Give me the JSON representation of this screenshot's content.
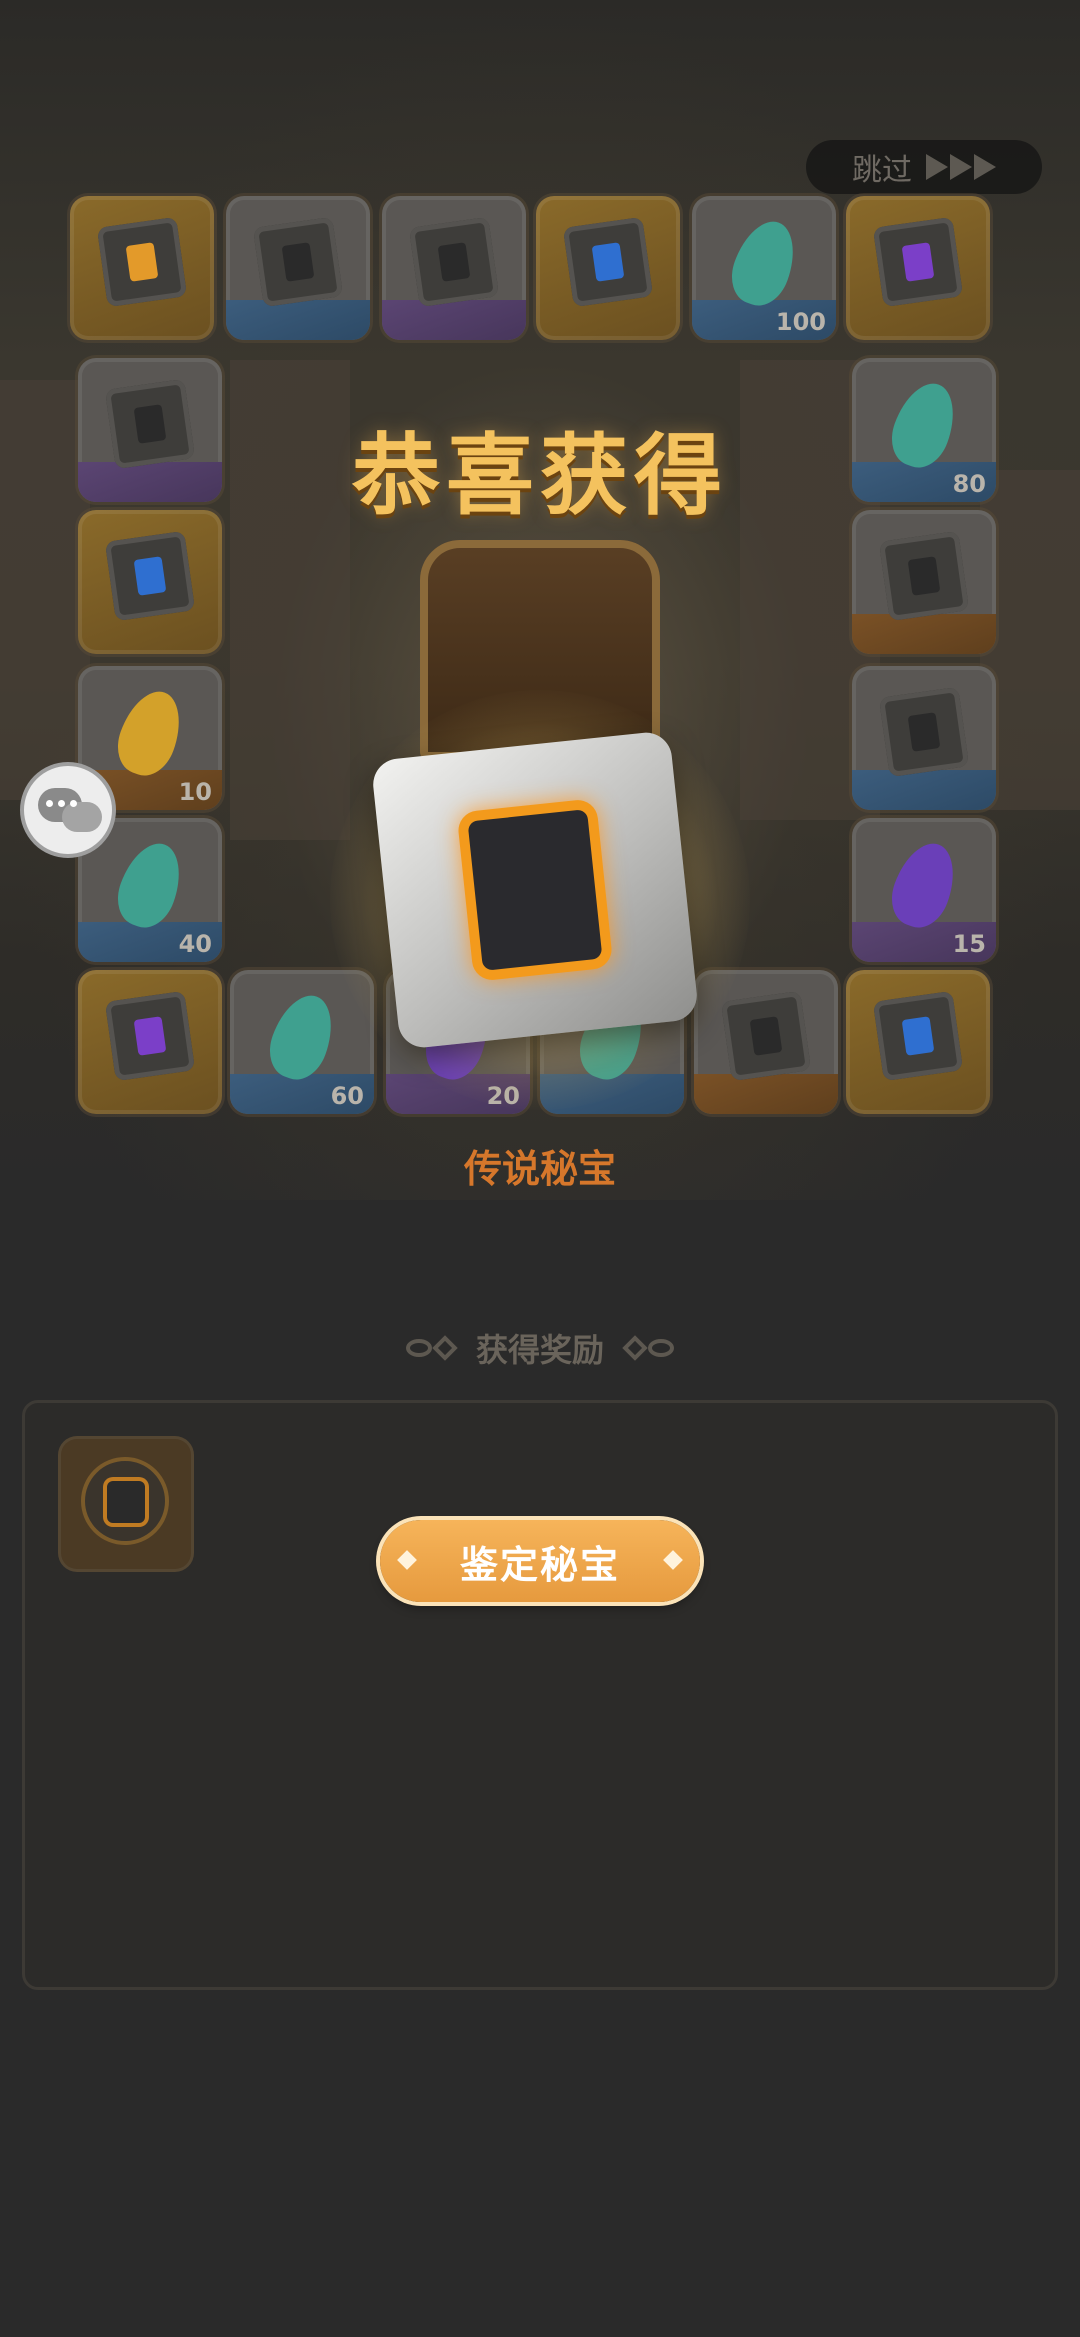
{
  "header": {
    "skip_label": "跳过"
  },
  "title": "恭喜获得",
  "item": {
    "name": "传说秘宝"
  },
  "rewards": {
    "header": "获得奖励"
  },
  "actions": {
    "appraise_label": "鉴定秘宝"
  },
  "grid_tiles": [
    {
      "type": "cube",
      "frame": "gold",
      "core": "#e39a2a"
    },
    {
      "type": "cube",
      "frame": "white",
      "band": "blue"
    },
    {
      "type": "cube",
      "frame": "white",
      "band": "purple"
    },
    {
      "type": "cube",
      "frame": "gold",
      "core": "#2f6fd0"
    },
    {
      "type": "crystal",
      "frame": "white",
      "band": "blue",
      "color": "#3fa08f",
      "count": "100"
    },
    {
      "type": "cube",
      "frame": "gold",
      "core": "#7b3fc8"
    },
    {
      "type": "cube",
      "frame": "white",
      "band": "purple"
    },
    {
      "type": "crystal",
      "frame": "white",
      "band": "blue",
      "color": "#3fa08f",
      "count": "80"
    },
    {
      "type": "cube",
      "frame": "gold",
      "core": "#2f6fd0"
    },
    {
      "type": "cube",
      "frame": "white",
      "band": "orange"
    },
    {
      "type": "crystal",
      "frame": "white",
      "band": "orange",
      "color": "#d3a12a",
      "count": "10"
    },
    {
      "type": "cube",
      "frame": "white",
      "band": "blue"
    },
    {
      "type": "crystal",
      "frame": "white",
      "band": "blue",
      "color": "#3fa08f",
      "count": "40"
    },
    {
      "type": "crystal",
      "frame": "white",
      "band": "purple",
      "color": "#6a3fb8",
      "count": "15"
    },
    {
      "type": "cube",
      "frame": "gold",
      "core": "#7b3fc8"
    },
    {
      "type": "crystal",
      "frame": "white",
      "band": "blue",
      "color": "#3fa08f",
      "count": "60"
    },
    {
      "type": "crystal",
      "frame": "white",
      "band": "purple",
      "color": "#6a3fb8",
      "count": "20"
    },
    {
      "type": "crystal",
      "frame": "white",
      "band": "blue",
      "color": "#3fa08f",
      "count": ""
    },
    {
      "type": "cube",
      "frame": "white",
      "band": "orange"
    },
    {
      "type": "cube",
      "frame": "gold",
      "core": "#2f6fd0"
    }
  ],
  "icons": {
    "skip": "triple-chevron-right-icon",
    "chat": "chat-bubbles-icon"
  },
  "colors": {
    "title": "#f4c25e",
    "item_name": "#d6772b",
    "button": "#e69a3e",
    "background": "#2a2a2a"
  }
}
